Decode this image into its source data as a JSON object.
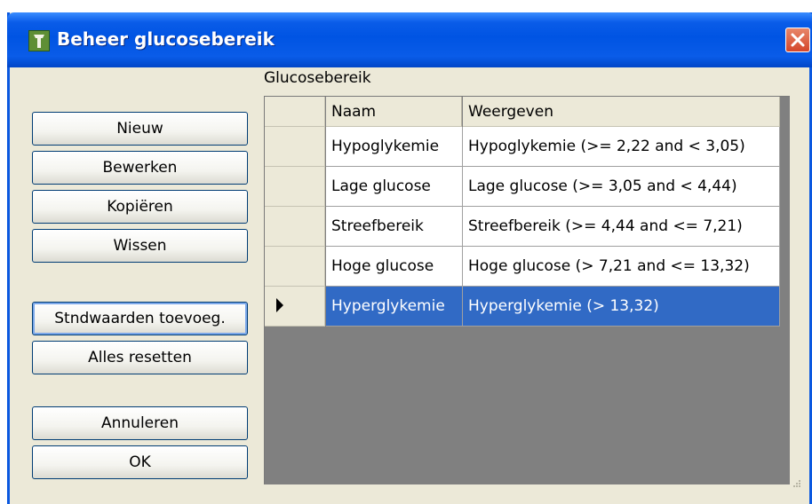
{
  "window": {
    "title": "Beheer glucosebereik"
  },
  "buttons": {
    "new": "Nieuw",
    "edit": "Bewerken",
    "copy": "Kopiëren",
    "delete": "Wissen",
    "add_defaults": "Stndwaarden toevoeg.",
    "reset_all": "Alles resetten",
    "cancel": "Annuleren",
    "ok": "OK"
  },
  "group": {
    "label": "Glucosebereik"
  },
  "grid": {
    "columns": [
      "Naam",
      "Weergeven"
    ],
    "rows": [
      {
        "naam": "Hypoglykemie",
        "weergeven": "Hypoglykemie (>= 2,22 and < 3,05)"
      },
      {
        "naam": "Lage glucose",
        "weergeven": "Lage glucose (>= 3,05 and < 4,44)"
      },
      {
        "naam": "Streefbereik",
        "weergeven": "Streefbereik (>= 4,44 and <= 7,21)"
      },
      {
        "naam": "Hoge glucose",
        "weergeven": "Hoge glucose (> 7,21 and <= 13,32)"
      },
      {
        "naam": "Hyperglykemie",
        "weergeven": "Hyperglykemie (> 13,32)"
      }
    ],
    "selected_row": 4
  },
  "colors": {
    "titlebar": "#0054e3",
    "selection": "#316ac5",
    "dialog_bg": "#ece9d8",
    "grid_bg": "#808080"
  },
  "icons": {
    "app": "app-icon",
    "close": "close-icon",
    "row_pointer": "row-pointer-icon"
  }
}
